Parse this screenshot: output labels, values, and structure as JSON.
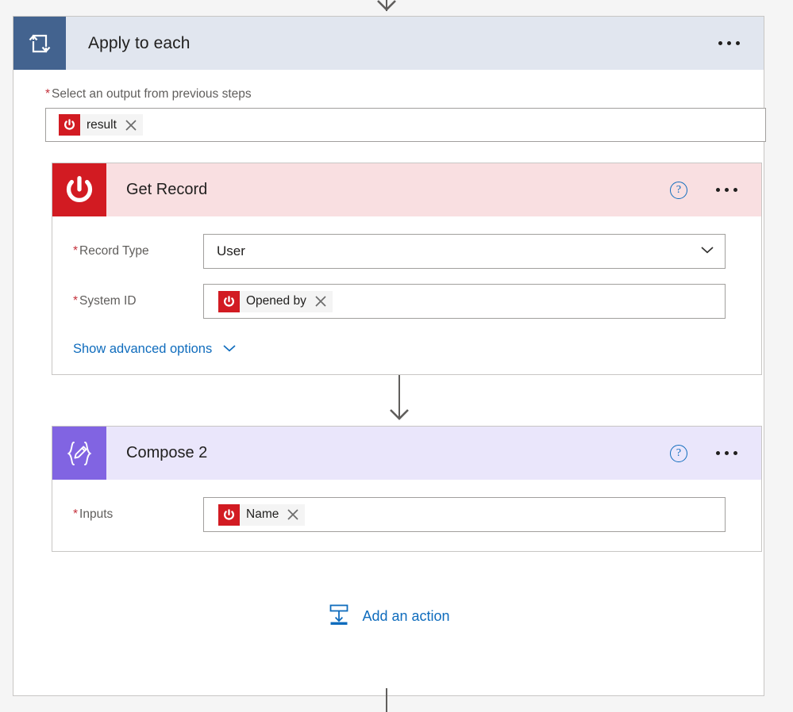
{
  "colors": {
    "page_background": "#f5f5f5",
    "loop_header": "#e1e6ef",
    "loop_icon_tile": "#43638f",
    "record_header": "#f9dfe1",
    "record_icon_tile": "#d21b22",
    "compose_header": "#eae6fb",
    "compose_icon_tile": "#8164e2",
    "link_blue": "#0f6cbd",
    "required_red": "#c4303b",
    "connector": "#605e5c"
  },
  "loop": {
    "title": "Apply to each",
    "icon": "loop-icon",
    "menu_icon": "ellipsis-icon",
    "input_label": "Select an output from previous steps",
    "required_marker": "*",
    "token": {
      "text": "result",
      "icon": "power-app-icon",
      "remove_icon": "close-icon"
    }
  },
  "get_record": {
    "title": "Get Record",
    "icon": "power-app-icon",
    "help_icon": "?",
    "menu_icon": "ellipsis-icon",
    "fields": [
      {
        "label": "Record Type",
        "required_marker": "*",
        "type": "dropdown",
        "value": "User",
        "chevron_icon": "chevron-down-icon"
      },
      {
        "label": "System ID",
        "required_marker": "*",
        "type": "token",
        "token": {
          "text": "Opened by",
          "icon": "power-app-icon",
          "remove_icon": "close-icon"
        }
      }
    ],
    "advanced_options_label": "Show advanced options",
    "advanced_options_icon": "chevron-down-icon"
  },
  "compose": {
    "title": "Compose 2",
    "icon": "compose-icon",
    "help_icon": "?",
    "menu_icon": "ellipsis-icon",
    "fields": [
      {
        "label": "Inputs",
        "required_marker": "*",
        "type": "token",
        "token": {
          "text": "Name",
          "icon": "power-app-icon",
          "remove_icon": "close-icon"
        }
      }
    ]
  },
  "add_action": {
    "label": "Add an action",
    "icon": "insert-below-icon"
  }
}
